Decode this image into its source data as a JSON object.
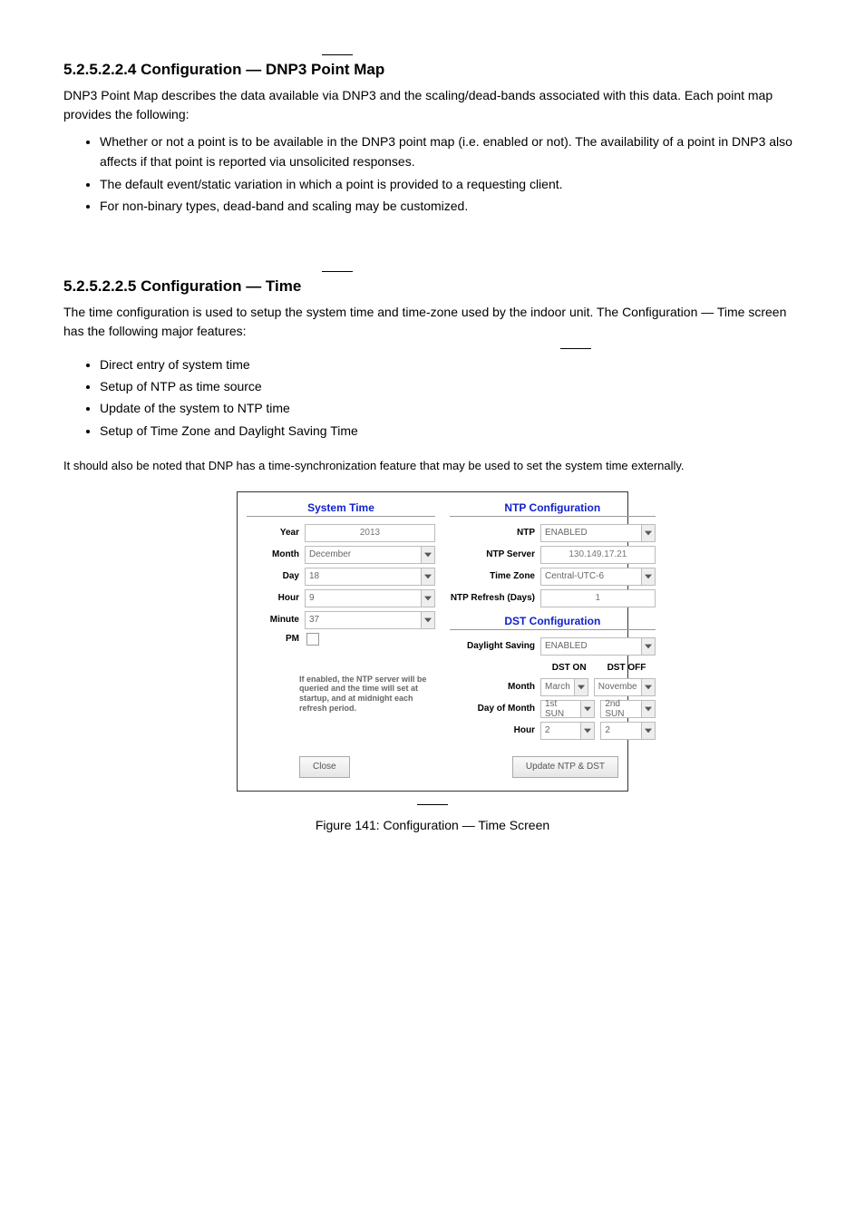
{
  "sec_a": {
    "title": "5.2.5.2.2.4  Configuration — DNP3 Point Map",
    "para": "DNP3 Point Map describes the data available via DNP3 and the scaling/dead-bands associated with this data. Each point map provides the following:",
    "bullets": [
      "Whether or not a point is to be available in the DNP3 point map (i.e. enabled or not). The availability of a point in DNP3 also affects if that point is reported via unsolicited responses.",
      "The default event/static variation in which a point is provided to a requesting client.",
      "For non-binary types, dead-band and scaling may be customized."
    ]
  },
  "sec_b": {
    "title": "5.2.5.2.2.5  Configuration — Time",
    "para": "The time configuration is used to setup the system time and time-zone used by the indoor unit. The Configuration — Time screen has the following major features:",
    "bullets": [
      "Direct entry of system time",
      "Setup of NTP as time source",
      "Update of the system to NTP time",
      "Setup of Time Zone and Daylight Saving Time"
    ],
    "para2": "It should also be noted that DNP has a time-synchronization feature that may be used to set the system time externally.",
    "fig_cap": "Figure 141: Configuration — Time Screen"
  },
  "dialog": {
    "left_title": "System Time",
    "right_title": "NTP Configuration",
    "right_title2": "DST Configuration",
    "year_lbl": "Year",
    "year_val": "2013",
    "month_lbl": "Month",
    "month_val": "December",
    "day_lbl": "Day",
    "day_val": "18",
    "hour_lbl": "Hour",
    "hour_val": "9",
    "minute_lbl": "Minute",
    "minute_val": "37",
    "pm_lbl": "PM",
    "ntp_lbl": "NTP",
    "ntp_val": "ENABLED",
    "ntpserver_lbl": "NTP Server",
    "ntpserver_val": "130.149.17.21",
    "tz_lbl": "Time Zone",
    "tz_val": "Central-UTC-6",
    "ntprefresh_lbl": "NTP Refresh (Days)",
    "ntprefresh_val": "1",
    "dst_lbl": "Daylight Saving",
    "dst_val": "ENABLED",
    "dston_head": "DST ON",
    "dstoff_head": "DST OFF",
    "mon_lbl": "Month",
    "mon_on": "March",
    "mon_off": "Novembe",
    "dom_lbl": "Day of Month",
    "dom_on": "1st SUN",
    "dom_off": "2nd SUN",
    "hr_lbl": "Hour",
    "hr_on": "2",
    "hr_off": "2",
    "note": "If enabled, the NTP server will be queried and the time will set at startup, and at midnight each refresh period.",
    "close": "Close",
    "update": "Update NTP & DST"
  }
}
